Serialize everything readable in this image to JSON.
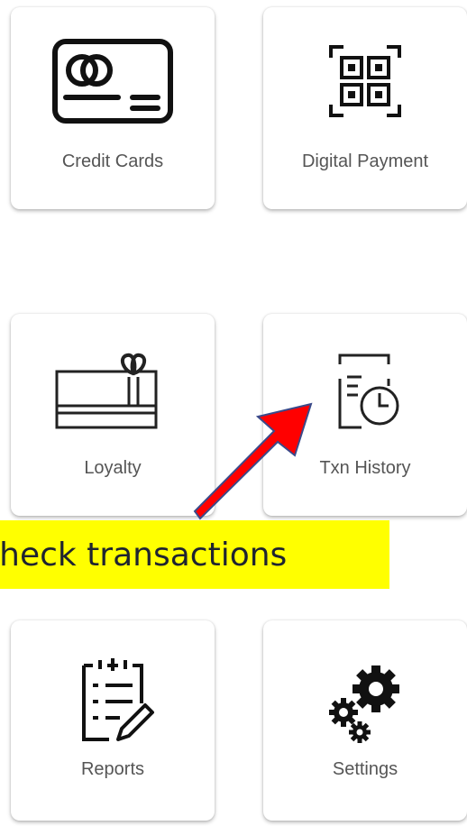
{
  "tiles": [
    {
      "label": "Credit Cards",
      "icon": "credit-card-icon"
    },
    {
      "label": "Digital Payment",
      "icon": "qr-code-icon"
    },
    {
      "label": "Loyalty",
      "icon": "gift-card-icon"
    },
    {
      "label": "Txn History",
      "icon": "document-clock-icon"
    },
    {
      "label": "Reports",
      "icon": "clipboard-list-icon"
    },
    {
      "label": "Settings",
      "icon": "gears-icon"
    }
  ],
  "callout": {
    "text": "Check transactions",
    "background": "#ffff00"
  },
  "arrow": {
    "fill": "#ff0000",
    "stroke": "#3a4a8a"
  }
}
